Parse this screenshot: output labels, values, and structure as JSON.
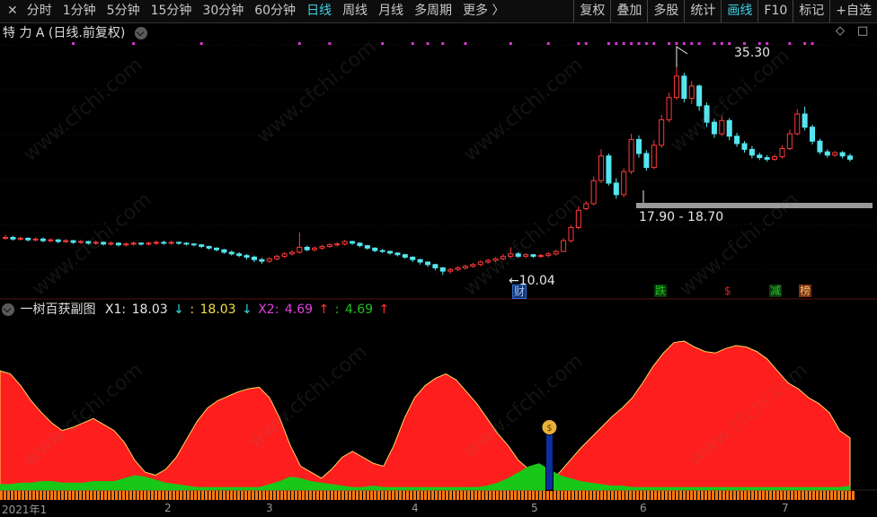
{
  "toolbar": {
    "left_items": [
      {
        "label": "分时",
        "active": false
      },
      {
        "label": "1分钟",
        "active": false
      },
      {
        "label": "5分钟",
        "active": false
      },
      {
        "label": "15分钟",
        "active": false
      },
      {
        "label": "30分钟",
        "active": false
      },
      {
        "label": "60分钟",
        "active": false
      },
      {
        "label": "日线",
        "active": true
      },
      {
        "label": "周线",
        "active": false
      },
      {
        "label": "月线",
        "active": false
      },
      {
        "label": "多周期",
        "active": false
      },
      {
        "label": "更多 〉",
        "active": false
      }
    ],
    "right_items": [
      {
        "label": "复权",
        "active": false
      },
      {
        "label": "叠加",
        "active": false
      },
      {
        "label": "多股",
        "active": false
      },
      {
        "label": "统计",
        "active": false
      },
      {
        "label": "画线",
        "active": true
      },
      {
        "label": "F10",
        "active": false
      },
      {
        "label": "标记",
        "active": false
      },
      {
        "label": "+自选",
        "active": false
      }
    ],
    "close_glyph": "✕"
  },
  "main_chart": {
    "title": "特 力 A (日线.前复权)",
    "icons": [
      "diamond-icon",
      "square-icon"
    ],
    "high_label": "35.30",
    "low_label": "10.04",
    "range_label": "17.90 - 18.70",
    "badges": [
      {
        "text": "财",
        "color": "#2f6fd6",
        "bg": "#16356e"
      },
      {
        "text": "跌",
        "color": "#21c421",
        "bg": "#0b3b0b"
      },
      {
        "text": "$",
        "color": "#e02020",
        "bg": "#000000"
      },
      {
        "text": "减",
        "color": "#21c421",
        "bg": "#0b3b0b"
      },
      {
        "text": "榜",
        "color": "#f0c070",
        "bg": "#7a3010"
      }
    ]
  },
  "sub_chart": {
    "name": "一树百获副图",
    "x1_label": "X1:",
    "x1_value": "18.03",
    "x1_arrow": "↓",
    "x1b_label": ":",
    "x1b_value": "18.03",
    "x1b_arrow": "↓",
    "x2_label": "X2:",
    "x2_value": "4.69",
    "x2_arrow": "↑",
    "x2b_label": ":",
    "x2b_value": "4.69",
    "x2b_arrow": "↑",
    "colors": {
      "x1": "#e6e6e6",
      "x1b": "#f0e040",
      "x2": "#e040e0",
      "x2b": "#20c020",
      "down": "#3fd2e6",
      "up": "#ff3030"
    }
  },
  "date_axis": [
    "2021年1",
    "2",
    "3",
    "4",
    "5",
    "6",
    "7"
  ],
  "watermark": "www.cfchi.com",
  "chart_data": {
    "type": "candlestick",
    "title": "特 力 A (日线.前复权)",
    "period": "日线",
    "adjust": "前复权",
    "ylim": [
      8,
      38
    ],
    "high_marker": 35.3,
    "low_marker": 10.04,
    "range_marker": [
      17.9,
      18.7
    ],
    "x_ticks": [
      "2021年1",
      "2",
      "3",
      "4",
      "5",
      "6",
      "7"
    ],
    "candles": [
      [
        14.5,
        14.6,
        14.9,
        14.3
      ],
      [
        14.6,
        14.4,
        14.8,
        14.2
      ],
      [
        14.4,
        14.5,
        14.7,
        14.2
      ],
      [
        14.5,
        14.3,
        14.6,
        14.1
      ],
      [
        14.3,
        14.4,
        14.6,
        14.1
      ],
      [
        14.4,
        14.2,
        14.6,
        14.0
      ],
      [
        14.2,
        14.3,
        14.5,
        14.0
      ],
      [
        14.3,
        14.1,
        14.4,
        13.9
      ],
      [
        14.1,
        14.2,
        14.4,
        13.9
      ],
      [
        14.2,
        14.0,
        14.3,
        13.8
      ],
      [
        14.0,
        14.1,
        14.3,
        13.8
      ],
      [
        14.1,
        13.9,
        14.2,
        13.7
      ],
      [
        13.9,
        14.0,
        14.2,
        13.7
      ],
      [
        14.0,
        13.8,
        14.1,
        13.6
      ],
      [
        13.8,
        13.9,
        14.1,
        13.6
      ],
      [
        13.9,
        13.7,
        14.0,
        13.5
      ],
      [
        13.7,
        13.8,
        14.0,
        13.5
      ],
      [
        13.8,
        13.9,
        14.1,
        13.6
      ],
      [
        13.9,
        13.8,
        14.0,
        13.6
      ],
      [
        13.8,
        13.9,
        14.1,
        13.6
      ],
      [
        13.9,
        14.0,
        14.2,
        13.7
      ],
      [
        14.0,
        13.9,
        14.2,
        13.7
      ],
      [
        13.9,
        14.0,
        14.2,
        13.7
      ],
      [
        14.0,
        13.9,
        14.1,
        13.7
      ],
      [
        13.9,
        13.8,
        14.0,
        13.6
      ],
      [
        13.8,
        13.7,
        13.9,
        13.5
      ],
      [
        13.7,
        13.5,
        13.8,
        13.3
      ],
      [
        13.5,
        13.3,
        13.6,
        13.1
      ],
      [
        13.3,
        13.1,
        13.4,
        12.9
      ],
      [
        13.1,
        12.8,
        13.2,
        12.6
      ],
      [
        12.8,
        12.6,
        13.0,
        12.4
      ],
      [
        12.6,
        12.4,
        12.8,
        12.2
      ],
      [
        12.4,
        12.2,
        12.6,
        11.9
      ],
      [
        12.2,
        11.9,
        12.4,
        11.6
      ],
      [
        11.9,
        11.7,
        12.1,
        11.4
      ],
      [
        11.7,
        12.0,
        12.2,
        11.5
      ],
      [
        12.0,
        12.3,
        12.5,
        11.8
      ],
      [
        12.3,
        12.6,
        12.8,
        12.1
      ],
      [
        12.6,
        12.8,
        13.0,
        12.4
      ],
      [
        12.8,
        13.4,
        15.2,
        12.6
      ],
      [
        13.4,
        13.1,
        13.6,
        12.9
      ],
      [
        13.1,
        13.3,
        13.5,
        12.9
      ],
      [
        13.3,
        13.5,
        13.7,
        13.1
      ],
      [
        13.5,
        13.7,
        13.9,
        13.3
      ],
      [
        13.7,
        13.8,
        14.0,
        13.5
      ],
      [
        13.8,
        14.1,
        14.3,
        13.6
      ],
      [
        14.1,
        13.9,
        14.2,
        13.7
      ],
      [
        13.9,
        13.6,
        14.0,
        13.4
      ],
      [
        13.6,
        13.3,
        13.7,
        13.1
      ],
      [
        13.3,
        13.0,
        13.4,
        12.8
      ],
      [
        13.0,
        12.9,
        13.2,
        12.7
      ],
      [
        12.9,
        12.7,
        13.0,
        12.5
      ],
      [
        12.7,
        12.5,
        12.8,
        12.3
      ],
      [
        12.5,
        12.2,
        12.6,
        12.0
      ],
      [
        12.2,
        11.9,
        12.3,
        11.6
      ],
      [
        11.9,
        11.6,
        12.0,
        11.3
      ],
      [
        11.6,
        11.3,
        11.7,
        11.0
      ],
      [
        11.3,
        10.9,
        11.4,
        10.6
      ],
      [
        10.9,
        10.5,
        11.0,
        10.04
      ],
      [
        10.5,
        10.7,
        10.9,
        10.2
      ],
      [
        10.7,
        10.9,
        11.1,
        10.5
      ],
      [
        10.9,
        11.1,
        11.3,
        10.7
      ],
      [
        11.1,
        11.3,
        11.5,
        10.9
      ],
      [
        11.3,
        11.6,
        11.8,
        11.1
      ],
      [
        11.6,
        11.8,
        12.0,
        11.4
      ],
      [
        11.8,
        12.0,
        12.2,
        11.6
      ],
      [
        12.0,
        12.3,
        12.6,
        11.8
      ],
      [
        12.3,
        12.6,
        13.4,
        12.1
      ],
      [
        12.6,
        12.3,
        12.8,
        12.1
      ],
      [
        12.3,
        12.5,
        12.7,
        12.1
      ],
      [
        12.5,
        12.3,
        12.6,
        12.1
      ],
      [
        12.3,
        12.4,
        12.6,
        12.1
      ],
      [
        12.4,
        12.6,
        12.8,
        12.2
      ],
      [
        12.6,
        12.9,
        13.1,
        12.4
      ],
      [
        12.9,
        14.2,
        14.5,
        12.8
      ],
      [
        14.2,
        15.8,
        16.1,
        14.0
      ],
      [
        15.8,
        17.9,
        18.4,
        15.6
      ],
      [
        18.1,
        18.7,
        19.0,
        17.9
      ],
      [
        18.7,
        21.5,
        22.0,
        18.5
      ],
      [
        21.5,
        24.5,
        25.3,
        21.2
      ],
      [
        24.5,
        21.2,
        24.8,
        20.9
      ],
      [
        21.2,
        19.8,
        21.8,
        19.3
      ],
      [
        19.8,
        22.6,
        23.0,
        19.5
      ],
      [
        22.6,
        26.5,
        27.2,
        22.3
      ],
      [
        26.5,
        24.8,
        27.0,
        24.3
      ],
      [
        24.8,
        23.1,
        25.2,
        22.7
      ],
      [
        23.1,
        25.8,
        26.4,
        22.9
      ],
      [
        25.8,
        28.9,
        29.5,
        25.5
      ],
      [
        28.9,
        31.6,
        32.2,
        28.6
      ],
      [
        31.6,
        34.2,
        35.3,
        31.3
      ],
      [
        34.2,
        31.5,
        34.6,
        31.0
      ],
      [
        31.5,
        33.0,
        33.6,
        30.8
      ],
      [
        33.0,
        30.6,
        33.2,
        30.0
      ],
      [
        30.6,
        28.6,
        31.0,
        28.0
      ],
      [
        28.6,
        27.2,
        29.0,
        26.7
      ],
      [
        27.2,
        28.8,
        29.4,
        26.9
      ],
      [
        28.8,
        26.9,
        29.1,
        26.4
      ],
      [
        26.9,
        26.0,
        27.3,
        25.6
      ],
      [
        26.0,
        25.3,
        26.3,
        24.9
      ],
      [
        25.3,
        24.6,
        25.7,
        24.2
      ],
      [
        24.6,
        24.3,
        24.9,
        24.0
      ],
      [
        24.3,
        24.1,
        24.6,
        23.8
      ],
      [
        24.1,
        24.4,
        24.7,
        23.9
      ],
      [
        24.4,
        25.4,
        25.8,
        24.2
      ],
      [
        25.4,
        27.2,
        27.7,
        25.2
      ],
      [
        27.2,
        29.6,
        30.2,
        27.0
      ],
      [
        29.6,
        28.0,
        30.5,
        27.6
      ],
      [
        28.0,
        26.3,
        28.3,
        25.9
      ],
      [
        26.3,
        25.0,
        26.6,
        24.7
      ],
      [
        25.0,
        24.6,
        25.3,
        24.3
      ],
      [
        24.6,
        24.9,
        25.1,
        24.4
      ],
      [
        24.9,
        24.5,
        25.1,
        24.2
      ],
      [
        24.5,
        24.1,
        24.8,
        23.8
      ]
    ]
  }
}
